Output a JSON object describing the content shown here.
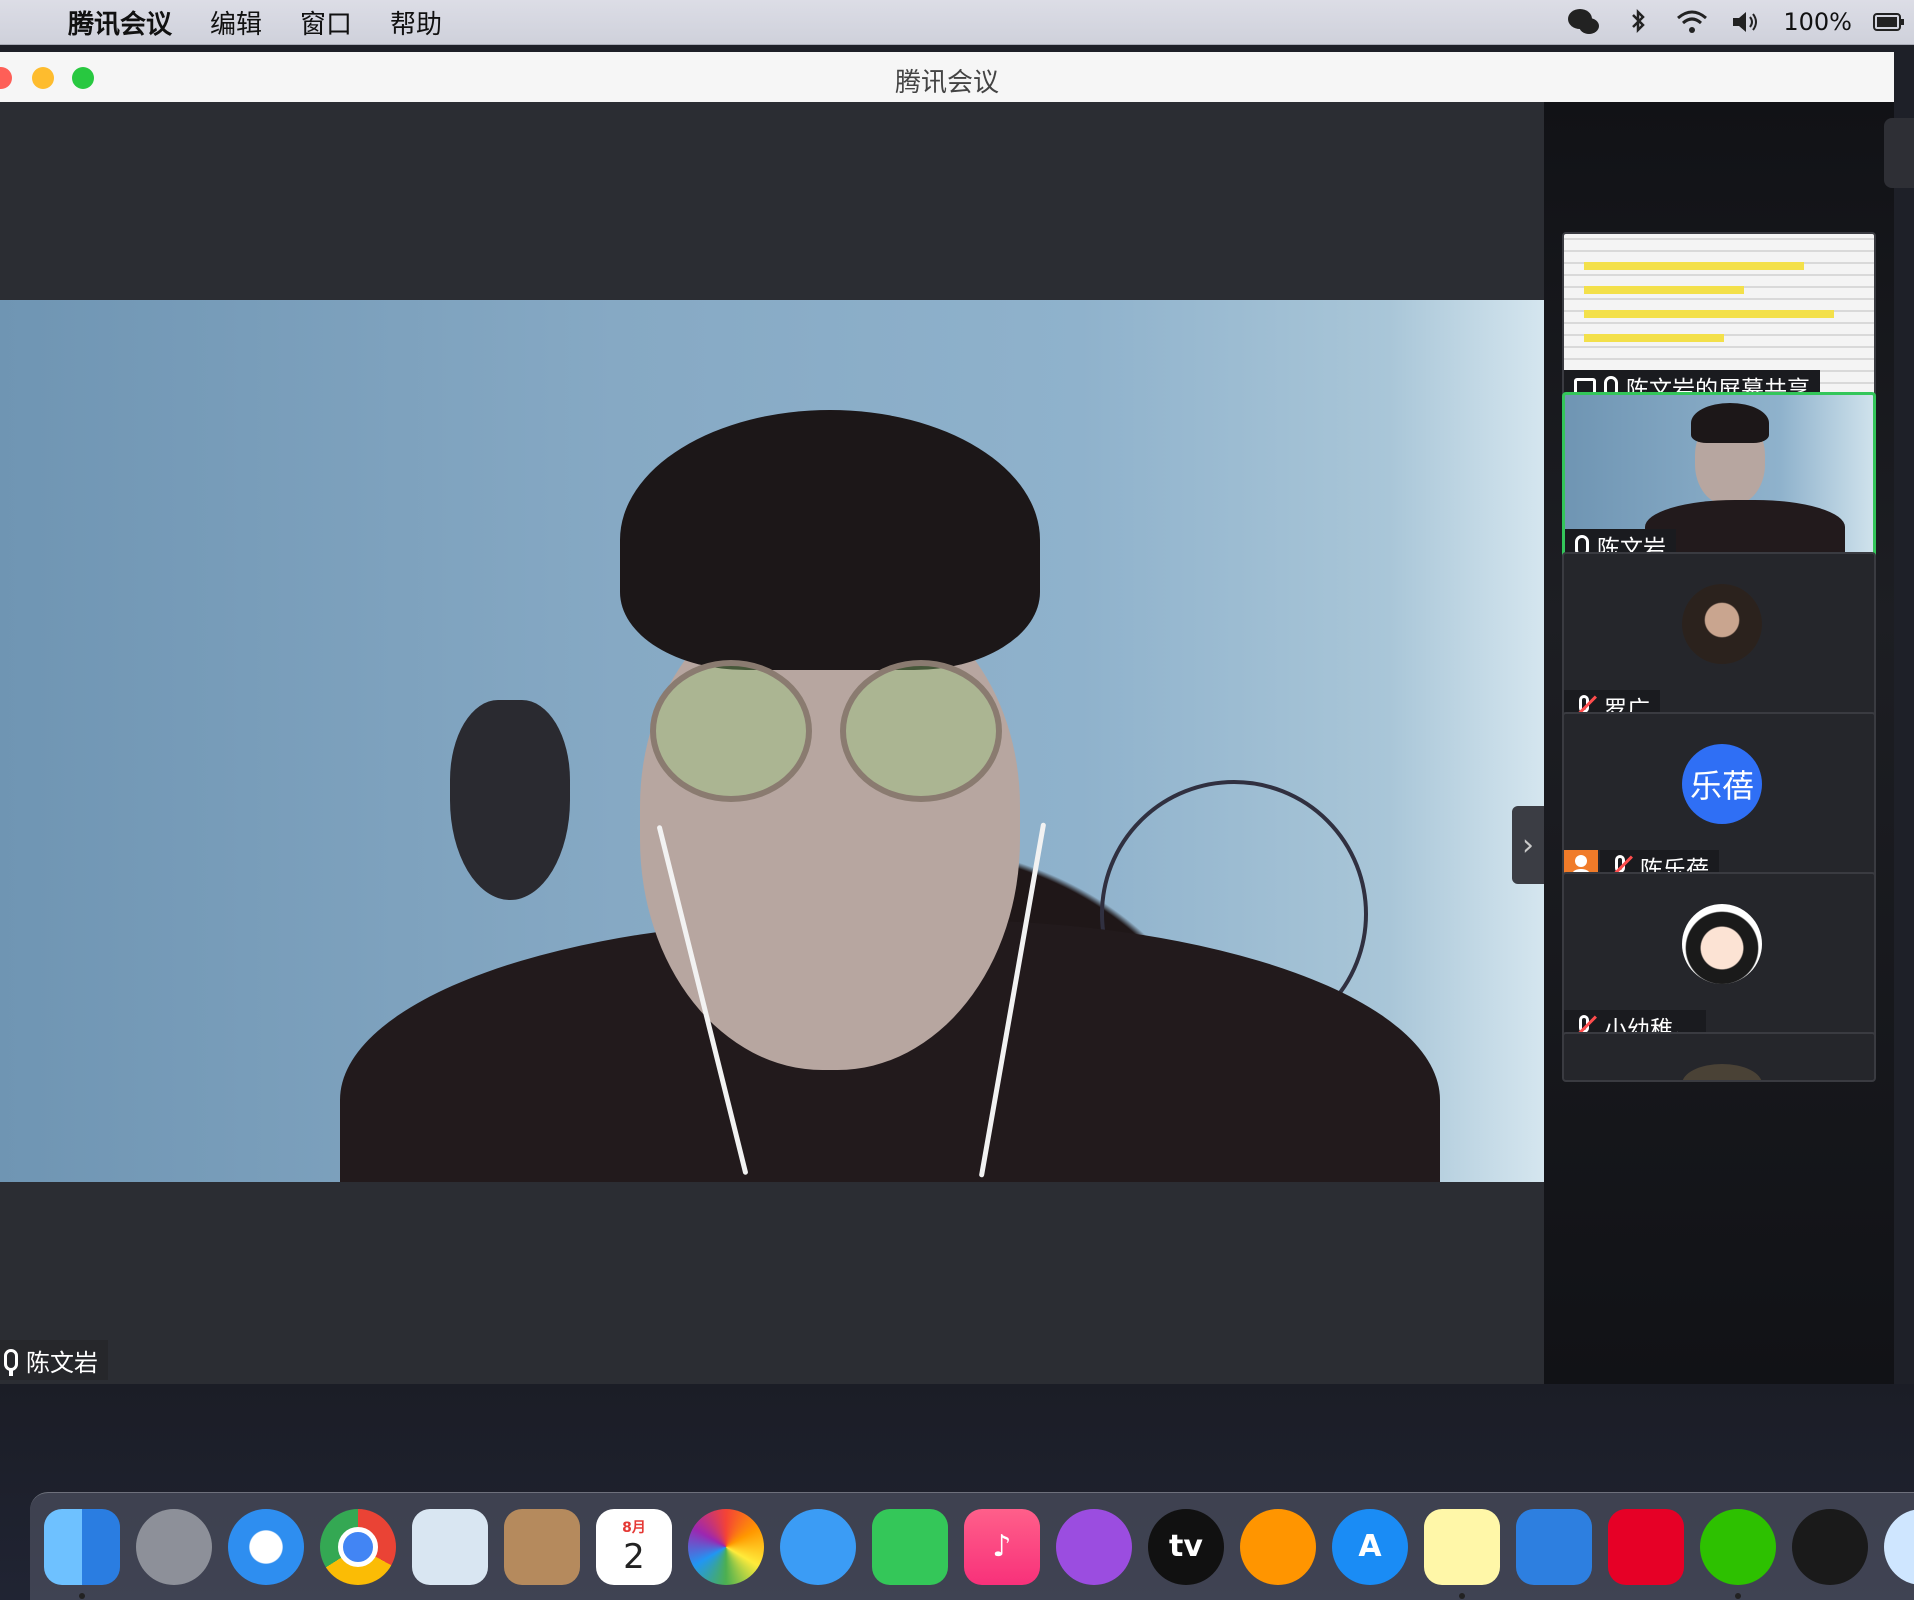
{
  "menubar": {
    "app_name": "腾讯会议",
    "items": [
      "编辑",
      "窗口",
      "帮助"
    ],
    "battery": "100%"
  },
  "window": {
    "title": "腾讯会议"
  },
  "main_video": {
    "speaker_name": "陈文岩"
  },
  "participants": [
    {
      "name": "陈文岩的屏幕共享",
      "kind": "screen-share"
    },
    {
      "name": "陈文岩",
      "kind": "video",
      "active": true
    },
    {
      "name": "罗广",
      "kind": "photo-avatar",
      "muted": true
    },
    {
      "name": "陈乐蓓",
      "kind": "text-avatar",
      "avatar_text": "乐蓓",
      "muted": true
    },
    {
      "name": "小幼稚。",
      "kind": "cartoon-avatar",
      "muted": true
    }
  ],
  "calendar": {
    "month": "8月",
    "day": "2"
  },
  "dock_icons": [
    "finder-icon",
    "launchpad-icon",
    "safari-icon",
    "chrome-icon",
    "mail-icon",
    "contacts-icon",
    "calendar-icon",
    "photos-icon",
    "messages-icon",
    "facetime-icon",
    "music-icon",
    "podcasts-icon",
    "tv-icon",
    "books-icon",
    "app-store-icon",
    "notes-icon",
    "cloud-icon",
    "netease-music-icon",
    "wechat-icon",
    "qq-icon",
    "extra-icon"
  ],
  "colors": {
    "active_border": "#33c65a",
    "avatar_blue": "#2f6ff5",
    "muted_red": "#ff4d4d"
  }
}
